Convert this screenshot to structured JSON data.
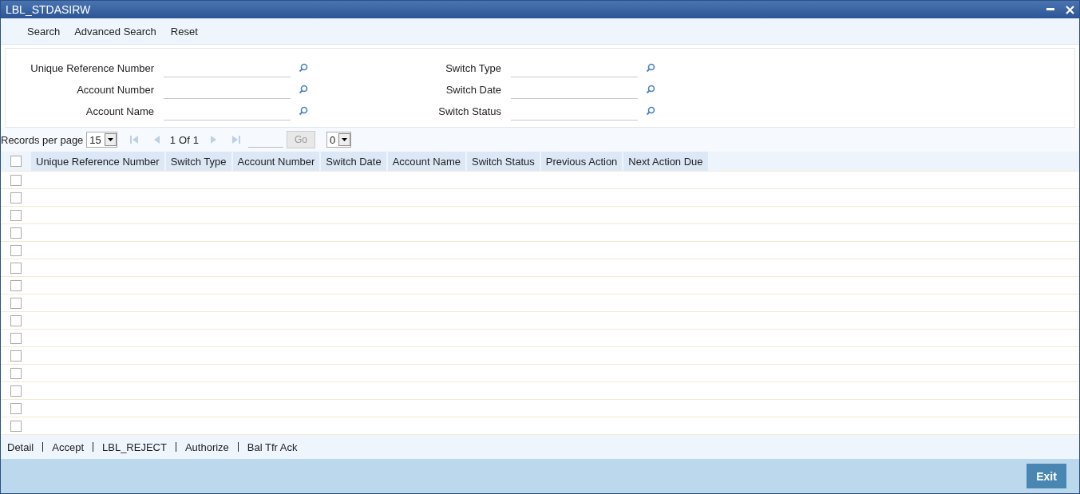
{
  "window": {
    "title": "LBL_STDASIRW"
  },
  "toolbar": [
    "Search",
    "Advanced Search",
    "Reset"
  ],
  "search_fields": {
    "left": [
      {
        "label": "Unique Reference Number"
      },
      {
        "label": "Account Number"
      },
      {
        "label": "Account Name"
      }
    ],
    "right": [
      {
        "label": "Switch Type"
      },
      {
        "label": "Switch Date"
      },
      {
        "label": "Switch Status"
      }
    ]
  },
  "pagination": {
    "label": "Records per page",
    "per_page": "15",
    "page": "1",
    "of": "Of",
    "total": "1",
    "go": "Go",
    "jump": "0"
  },
  "table": {
    "header_checked": false,
    "columns": [
      "Unique Reference Number",
      "Switch Type",
      "Account Number",
      "Switch Date",
      "Account Name",
      "Switch Status",
      "Previous Action",
      "Next Action Due"
    ],
    "rows": [
      {
        "checked": false
      },
      {
        "checked": false
      },
      {
        "checked": false
      },
      {
        "checked": false
      },
      {
        "checked": false
      },
      {
        "checked": false
      },
      {
        "checked": false
      },
      {
        "checked": false
      },
      {
        "checked": false
      },
      {
        "checked": false
      },
      {
        "checked": false
      },
      {
        "checked": false
      },
      {
        "checked": false
      },
      {
        "checked": false
      },
      {
        "checked": false
      }
    ]
  },
  "actions": [
    "Detail",
    "Accept",
    "LBL_REJECT",
    "Authorize",
    "Bal Tfr Ack"
  ],
  "footer": {
    "exit": "Exit"
  }
}
